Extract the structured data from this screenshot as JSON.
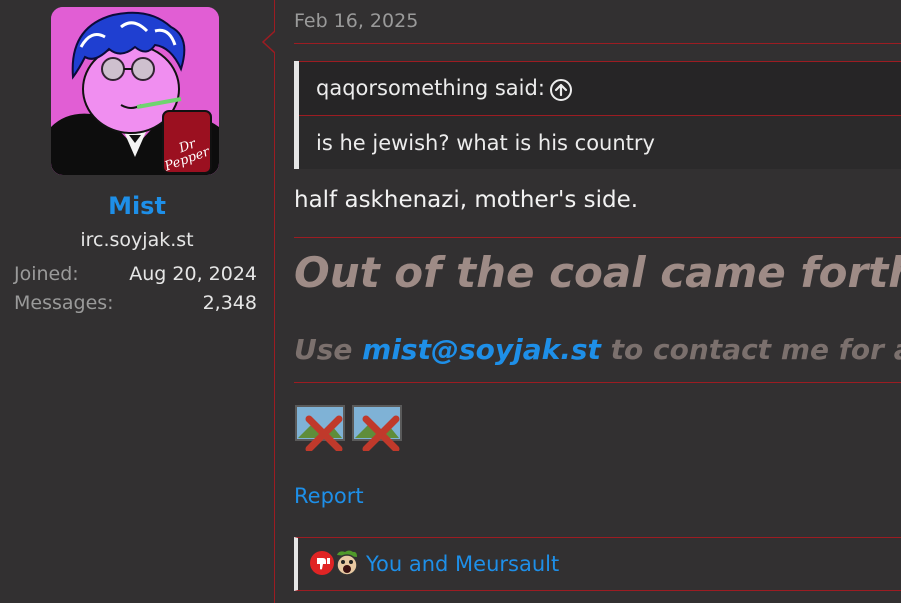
{
  "user": {
    "name": "Mist",
    "title": "irc.soyjak.st",
    "stats": [
      {
        "label": "Joined:",
        "value": "Aug 20, 2024"
      },
      {
        "label": "Messages:",
        "value": "2,348"
      }
    ],
    "avatar_badge": "Dr Pepper"
  },
  "post": {
    "date": "Feb 16, 2025",
    "quote": {
      "author": "qaqorsomething said:",
      "icon": "arrow-circle-up-icon",
      "text": "is he jewish? what is his country"
    },
    "reply": "half askhenazi, mother's side.",
    "signature": {
      "line1": "Out of the coal came forth sw",
      "line2_prefix": "Use ",
      "line2_email": "mist@soyjak.st",
      "line2_suffix": " to contact me for any"
    },
    "report_label": "Report",
    "reactions": {
      "icons": [
        "thumbs-down-icon",
        "soyjak-icon"
      ],
      "text": "You and Meursault"
    }
  },
  "colors": {
    "accent": "#1e8fe8",
    "border": "#9c1c22",
    "background": "#323031"
  }
}
